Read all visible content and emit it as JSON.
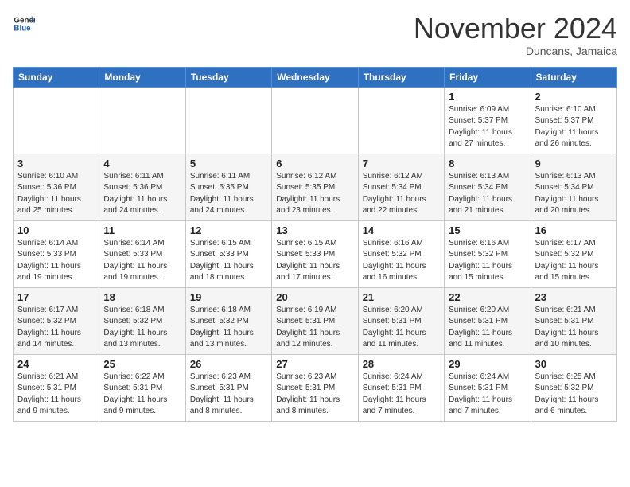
{
  "header": {
    "logo_general": "General",
    "logo_blue": "Blue",
    "month": "November 2024",
    "location": "Duncans, Jamaica"
  },
  "weekdays": [
    "Sunday",
    "Monday",
    "Tuesday",
    "Wednesday",
    "Thursday",
    "Friday",
    "Saturday"
  ],
  "weeks": [
    [
      {
        "day": "",
        "info": ""
      },
      {
        "day": "",
        "info": ""
      },
      {
        "day": "",
        "info": ""
      },
      {
        "day": "",
        "info": ""
      },
      {
        "day": "",
        "info": ""
      },
      {
        "day": "1",
        "info": "Sunrise: 6:09 AM\nSunset: 5:37 PM\nDaylight: 11 hours\nand 27 minutes."
      },
      {
        "day": "2",
        "info": "Sunrise: 6:10 AM\nSunset: 5:37 PM\nDaylight: 11 hours\nand 26 minutes."
      }
    ],
    [
      {
        "day": "3",
        "info": "Sunrise: 6:10 AM\nSunset: 5:36 PM\nDaylight: 11 hours\nand 25 minutes."
      },
      {
        "day": "4",
        "info": "Sunrise: 6:11 AM\nSunset: 5:36 PM\nDaylight: 11 hours\nand 24 minutes."
      },
      {
        "day": "5",
        "info": "Sunrise: 6:11 AM\nSunset: 5:35 PM\nDaylight: 11 hours\nand 24 minutes."
      },
      {
        "day": "6",
        "info": "Sunrise: 6:12 AM\nSunset: 5:35 PM\nDaylight: 11 hours\nand 23 minutes."
      },
      {
        "day": "7",
        "info": "Sunrise: 6:12 AM\nSunset: 5:34 PM\nDaylight: 11 hours\nand 22 minutes."
      },
      {
        "day": "8",
        "info": "Sunrise: 6:13 AM\nSunset: 5:34 PM\nDaylight: 11 hours\nand 21 minutes."
      },
      {
        "day": "9",
        "info": "Sunrise: 6:13 AM\nSunset: 5:34 PM\nDaylight: 11 hours\nand 20 minutes."
      }
    ],
    [
      {
        "day": "10",
        "info": "Sunrise: 6:14 AM\nSunset: 5:33 PM\nDaylight: 11 hours\nand 19 minutes."
      },
      {
        "day": "11",
        "info": "Sunrise: 6:14 AM\nSunset: 5:33 PM\nDaylight: 11 hours\nand 19 minutes."
      },
      {
        "day": "12",
        "info": "Sunrise: 6:15 AM\nSunset: 5:33 PM\nDaylight: 11 hours\nand 18 minutes."
      },
      {
        "day": "13",
        "info": "Sunrise: 6:15 AM\nSunset: 5:33 PM\nDaylight: 11 hours\nand 17 minutes."
      },
      {
        "day": "14",
        "info": "Sunrise: 6:16 AM\nSunset: 5:32 PM\nDaylight: 11 hours\nand 16 minutes."
      },
      {
        "day": "15",
        "info": "Sunrise: 6:16 AM\nSunset: 5:32 PM\nDaylight: 11 hours\nand 15 minutes."
      },
      {
        "day": "16",
        "info": "Sunrise: 6:17 AM\nSunset: 5:32 PM\nDaylight: 11 hours\nand 15 minutes."
      }
    ],
    [
      {
        "day": "17",
        "info": "Sunrise: 6:17 AM\nSunset: 5:32 PM\nDaylight: 11 hours\nand 14 minutes."
      },
      {
        "day": "18",
        "info": "Sunrise: 6:18 AM\nSunset: 5:32 PM\nDaylight: 11 hours\nand 13 minutes."
      },
      {
        "day": "19",
        "info": "Sunrise: 6:18 AM\nSunset: 5:32 PM\nDaylight: 11 hours\nand 13 minutes."
      },
      {
        "day": "20",
        "info": "Sunrise: 6:19 AM\nSunset: 5:31 PM\nDaylight: 11 hours\nand 12 minutes."
      },
      {
        "day": "21",
        "info": "Sunrise: 6:20 AM\nSunset: 5:31 PM\nDaylight: 11 hours\nand 11 minutes."
      },
      {
        "day": "22",
        "info": "Sunrise: 6:20 AM\nSunset: 5:31 PM\nDaylight: 11 hours\nand 11 minutes."
      },
      {
        "day": "23",
        "info": "Sunrise: 6:21 AM\nSunset: 5:31 PM\nDaylight: 11 hours\nand 10 minutes."
      }
    ],
    [
      {
        "day": "24",
        "info": "Sunrise: 6:21 AM\nSunset: 5:31 PM\nDaylight: 11 hours\nand 9 minutes."
      },
      {
        "day": "25",
        "info": "Sunrise: 6:22 AM\nSunset: 5:31 PM\nDaylight: 11 hours\nand 9 minutes."
      },
      {
        "day": "26",
        "info": "Sunrise: 6:23 AM\nSunset: 5:31 PM\nDaylight: 11 hours\nand 8 minutes."
      },
      {
        "day": "27",
        "info": "Sunrise: 6:23 AM\nSunset: 5:31 PM\nDaylight: 11 hours\nand 8 minutes."
      },
      {
        "day": "28",
        "info": "Sunrise: 6:24 AM\nSunset: 5:31 PM\nDaylight: 11 hours\nand 7 minutes."
      },
      {
        "day": "29",
        "info": "Sunrise: 6:24 AM\nSunset: 5:31 PM\nDaylight: 11 hours\nand 7 minutes."
      },
      {
        "day": "30",
        "info": "Sunrise: 6:25 AM\nSunset: 5:32 PM\nDaylight: 11 hours\nand 6 minutes."
      }
    ]
  ]
}
